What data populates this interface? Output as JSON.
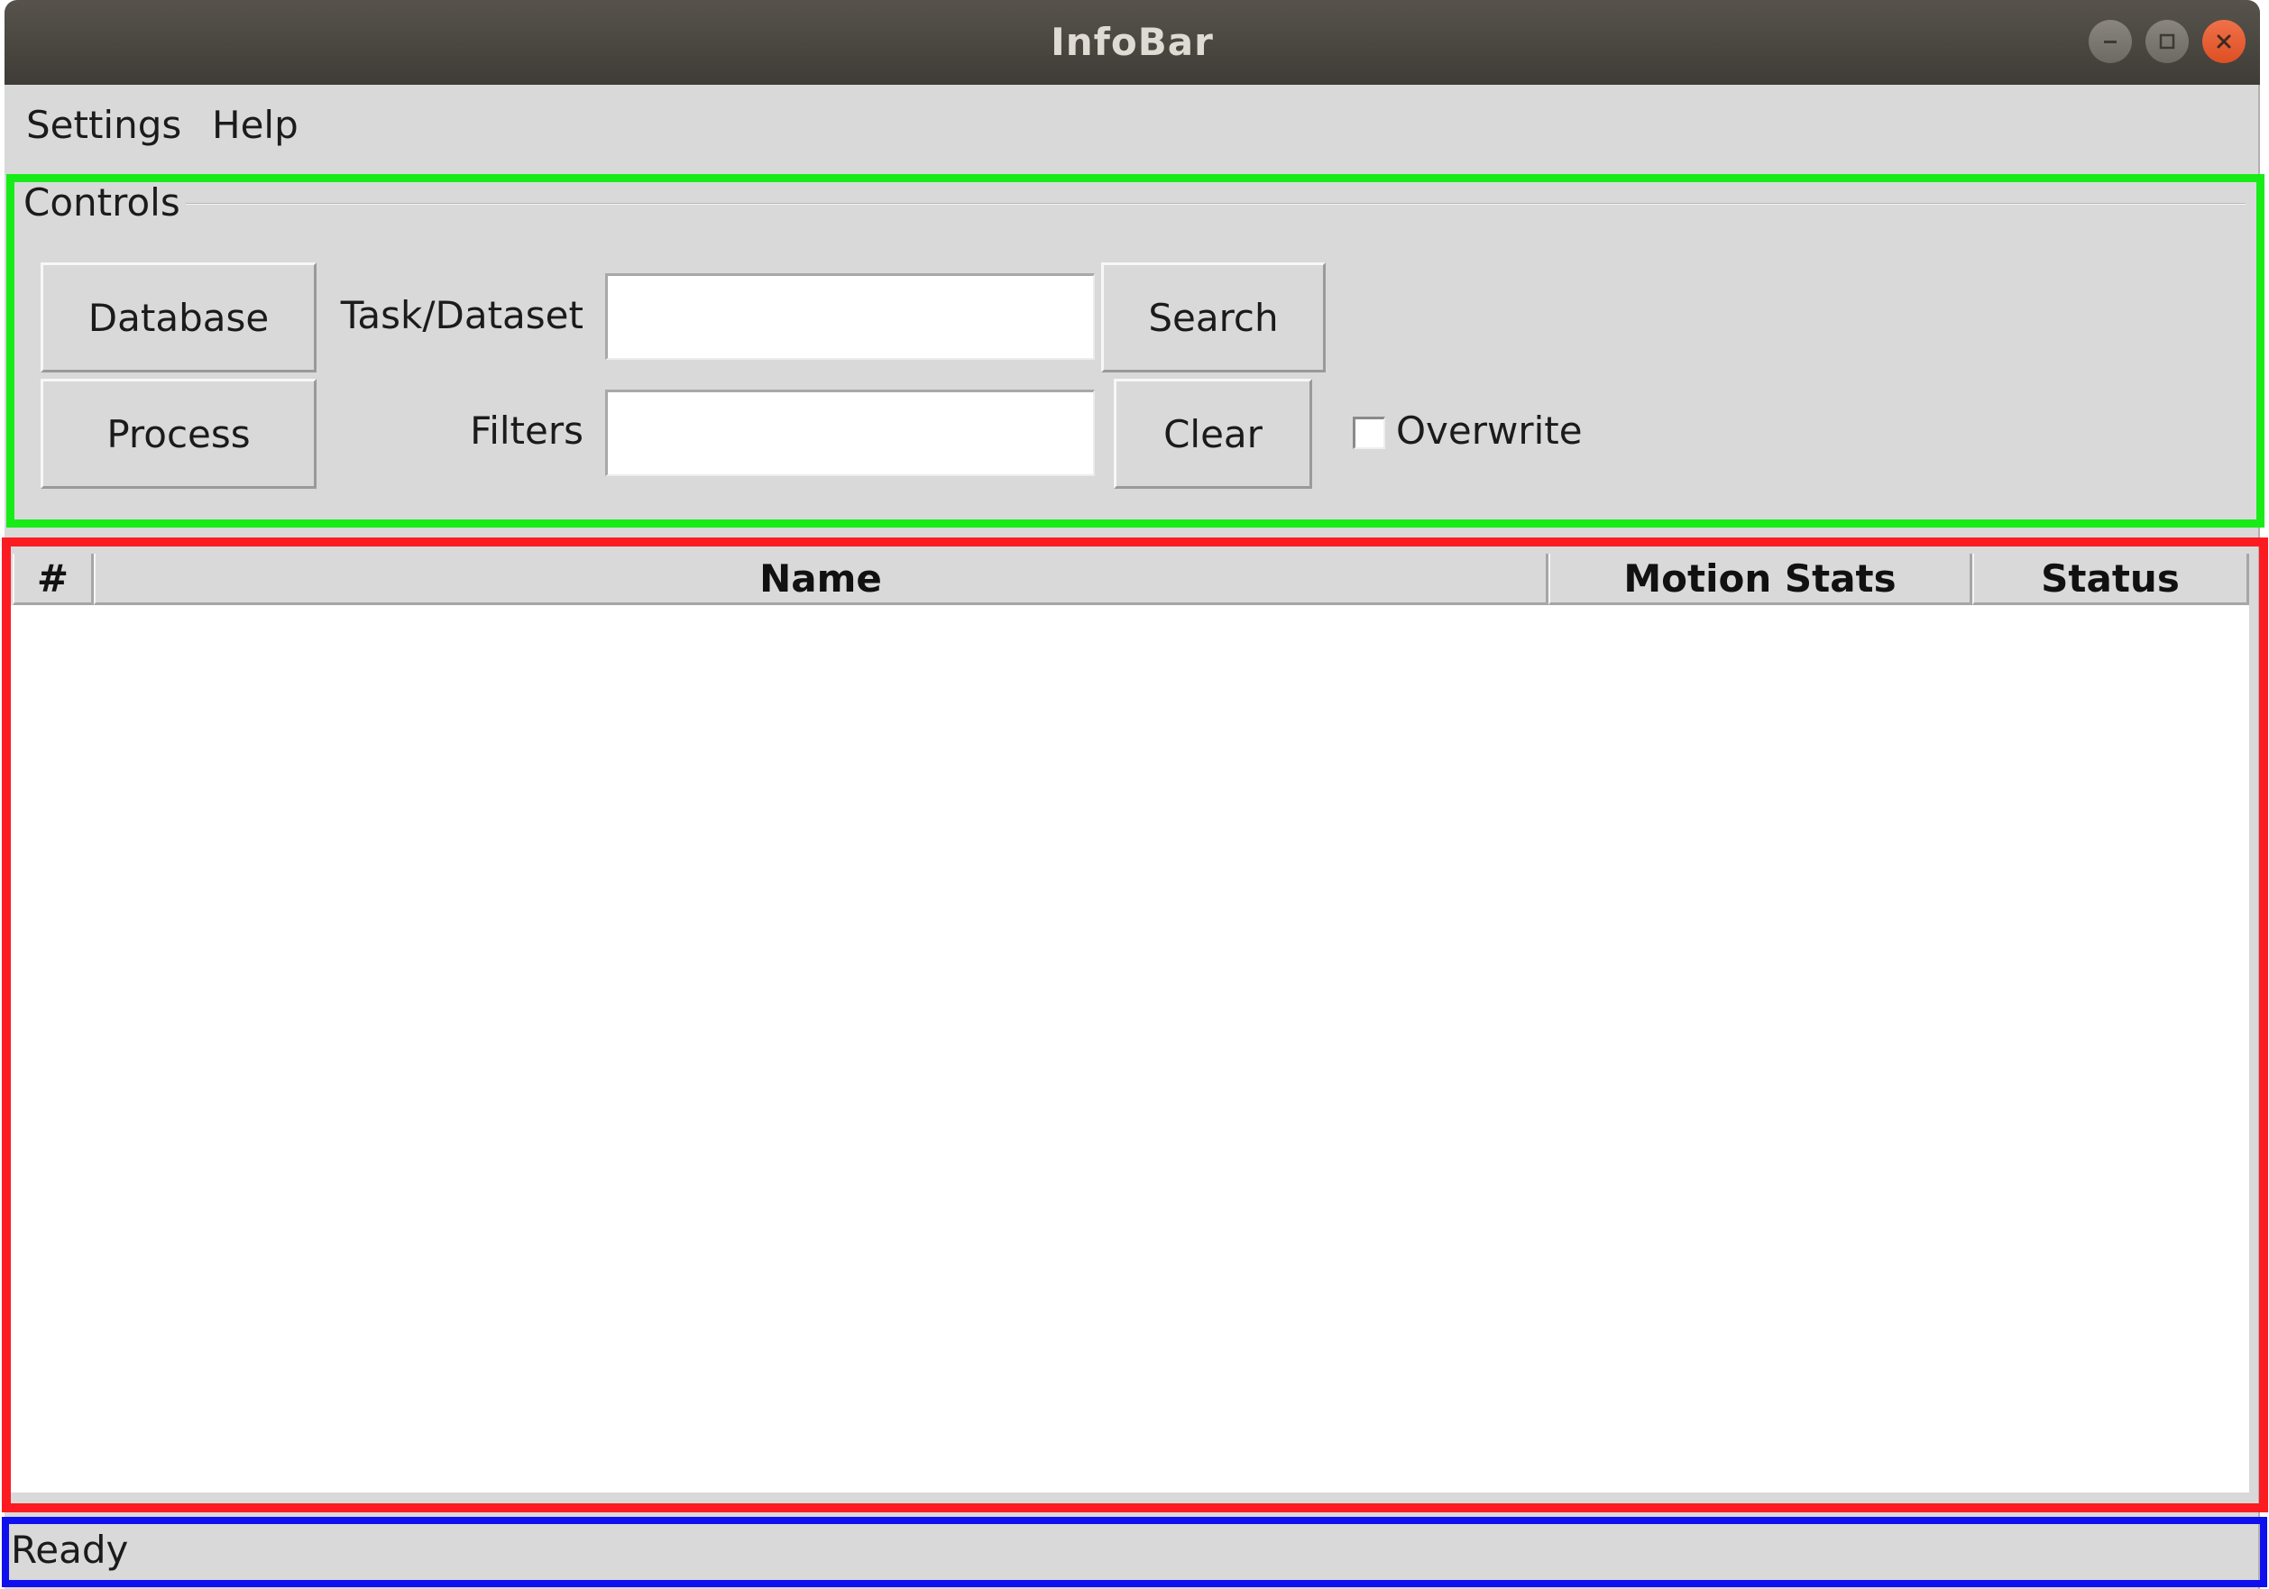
{
  "window": {
    "title": "InfoBar"
  },
  "menubar": {
    "items": [
      {
        "label": "Settings"
      },
      {
        "label": "Help"
      }
    ]
  },
  "controls": {
    "group_label": "Controls",
    "database_button": "Database",
    "process_button": "Process",
    "task_dataset_label": "Task/Dataset",
    "task_dataset_value": "",
    "filters_label": "Filters",
    "filters_value": "",
    "search_button": "Search",
    "clear_button": "Clear",
    "overwrite_label": "Overwrite",
    "overwrite_checked": false
  },
  "table": {
    "columns": [
      "#",
      "Name",
      "Motion Stats",
      "Status"
    ],
    "rows": []
  },
  "statusbar": {
    "text": "Ready"
  },
  "colors": {
    "controls_highlight": "#18ec18",
    "table_highlight": "#fb1c22",
    "status_highlight": "#1010ee",
    "close_button": "#e95420"
  }
}
